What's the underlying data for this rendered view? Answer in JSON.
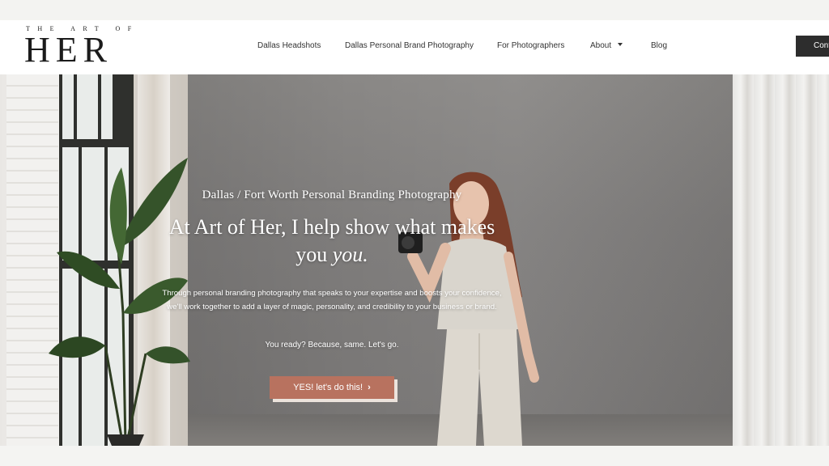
{
  "logo": {
    "top_text": "THE ART OF",
    "main_text": "HER"
  },
  "nav": {
    "items": [
      {
        "label": "Dallas Headshots"
      },
      {
        "label": "Dallas Personal Brand Photography"
      },
      {
        "label": "For Photographers"
      },
      {
        "label": "About"
      },
      {
        "label": "Blog"
      }
    ],
    "contact_label": "Contact"
  },
  "hero": {
    "subtitle": "Dallas / Fort Worth Personal Branding Photography",
    "headline_line1": "At Art of Her, I help show what makes",
    "headline_line2_prefix": "you ",
    "headline_line2_em": "you.",
    "body": "Through personal branding photography that speaks to your expertise and boosts your confidence, we'll work together to add a layer of magic, personality, and credibility to your business or brand.",
    "tagline": "You ready? Because, same.  Let's go.",
    "cta_label": "YES! let's do this!",
    "cta_icon": "chevron-right-icon"
  },
  "colors": {
    "cta_background": "#b8725f",
    "header_button": "#2d2d2d",
    "backdrop": "#807e7c"
  }
}
